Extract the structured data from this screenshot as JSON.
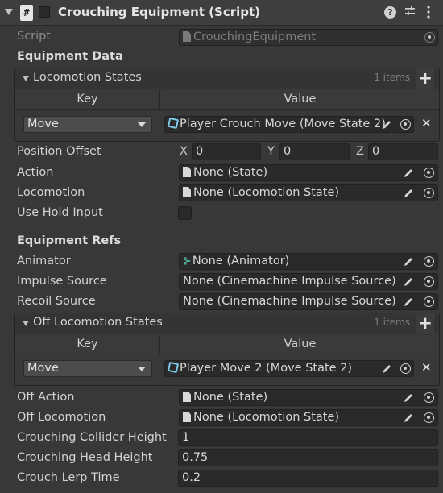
{
  "component": {
    "title": "Crouching Equipment (Script)",
    "script_label": "Script",
    "script_value": "CrouchingEquipment"
  },
  "equipment_data": {
    "heading": "Equipment Data",
    "locomotion_states": {
      "label": "Locomotion States",
      "count": "1 items",
      "col_key": "Key",
      "col_value": "Value",
      "row_key": "Move",
      "row_value": "Player Crouch Move (Move State 2)"
    },
    "position_offset": {
      "label": "Position Offset",
      "x_label": "X",
      "x": "0",
      "y_label": "Y",
      "y": "0",
      "z_label": "Z",
      "z": "0"
    },
    "action": {
      "label": "Action",
      "value": "None (State)"
    },
    "locomotion": {
      "label": "Locomotion",
      "value": "None (Locomotion State)"
    },
    "use_hold_input": {
      "label": "Use Hold Input",
      "checked": false
    }
  },
  "equipment_refs": {
    "heading": "Equipment Refs",
    "animator": {
      "label": "Animator",
      "value": "None (Animator)"
    },
    "impulse_source": {
      "label": "Impulse Source",
      "value": "None (Cinemachine Impulse Source)"
    },
    "recoil_source": {
      "label": "Recoil Source",
      "value": "None (Cinemachine Impulse Source)"
    },
    "off_locomotion_states": {
      "label": "Off Locomotion States",
      "count": "1 items",
      "col_key": "Key",
      "col_value": "Value",
      "row_key": "Move",
      "row_value": "Player Move 2 (Move State 2)"
    },
    "off_action": {
      "label": "Off Action",
      "value": "None (State)"
    },
    "off_locomotion": {
      "label": "Off Locomotion",
      "value": "None (Locomotion State)"
    },
    "crouching_collider_height": {
      "label": "Crouching Collider Height",
      "value": "1"
    },
    "crouching_head_height": {
      "label": "Crouching Head Height",
      "value": "0.75"
    },
    "crouch_lerp_time": {
      "label": "Crouch Lerp Time",
      "value": "0.2"
    }
  },
  "icons": {
    "header": [
      "fold-arrow-icon",
      "script-icon",
      "help-icon",
      "settings-icon",
      "more-icon"
    ],
    "field": [
      "file-icon",
      "scriptable-object-icon",
      "animator-icon",
      "pencil-icon",
      "target-icon"
    ]
  }
}
